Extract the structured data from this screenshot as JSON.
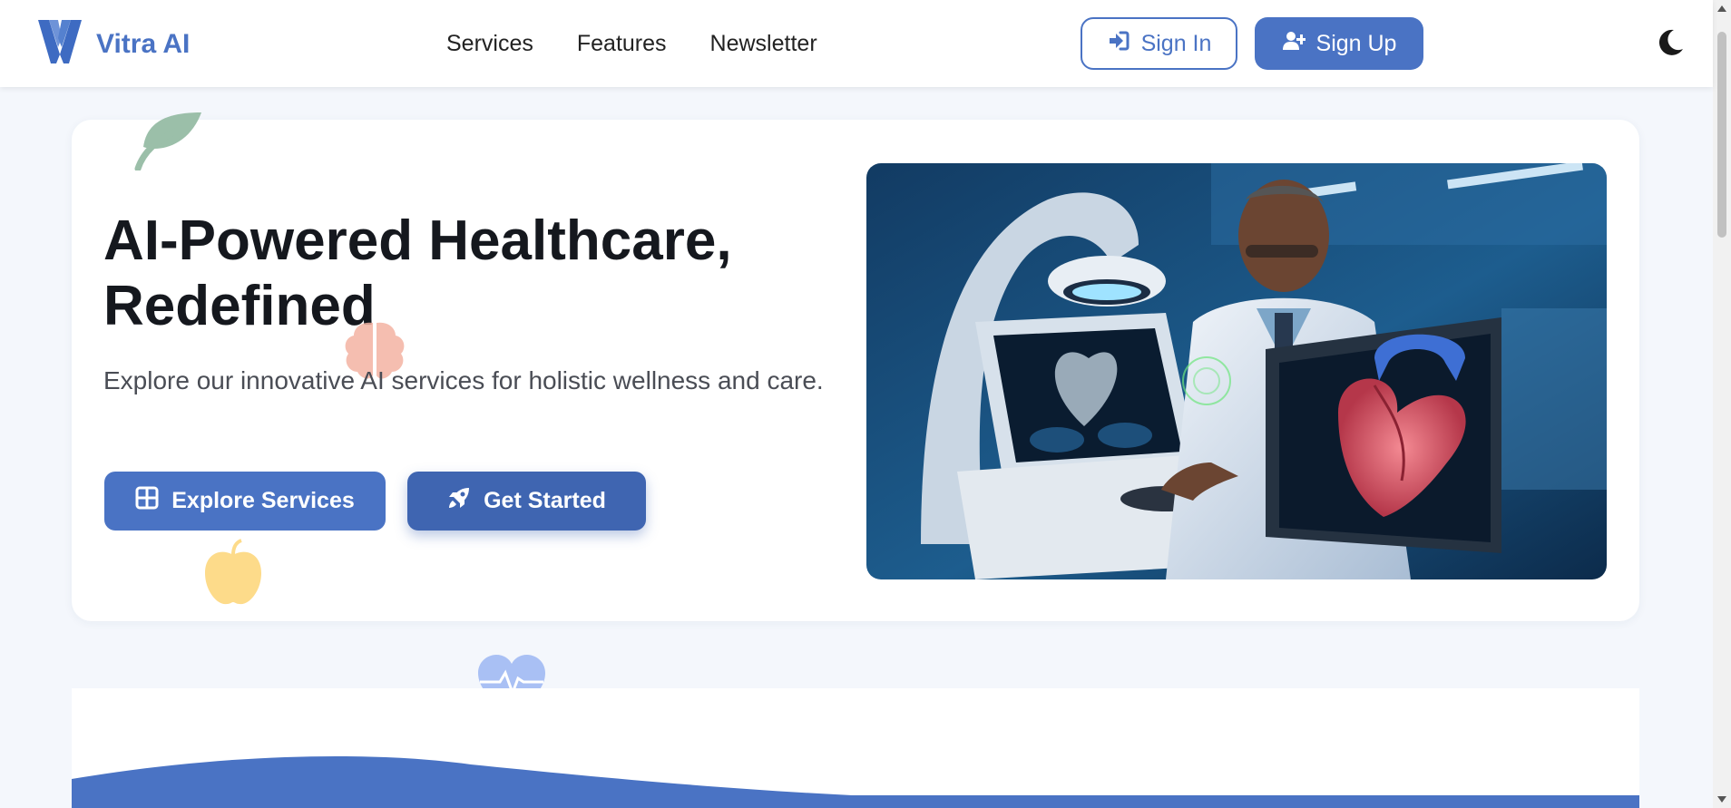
{
  "navbar": {
    "brand_name": "Vitra AI",
    "logo_icon": "vitra-logo-icon",
    "links": [
      {
        "label": "Services"
      },
      {
        "label": "Features"
      },
      {
        "label": "Newsletter"
      }
    ],
    "sign_in_label": "Sign In",
    "sign_in_icon": "sign-in-icon",
    "sign_up_label": "Sign Up",
    "sign_up_icon": "user-plus-icon",
    "theme_icon": "moon-icon"
  },
  "hero": {
    "title": "AI-Powered Healthcare, Redefined",
    "subtitle": "Explore our innovative AI services for holistic wellness and care.",
    "explore_label": "Explore Services",
    "explore_icon": "grid-icon",
    "get_started_label": "Get Started",
    "get_started_icon": "rocket-icon",
    "image_icon": "doctor-heart-scan-image"
  },
  "decor_icons": [
    "leaf-icon",
    "brain-icon",
    "apple-icon",
    "heart-pulse-icon"
  ],
  "colors": {
    "primary": "#4a73c4",
    "primary_dark": "#3f65b1",
    "background": "#f4f7fc",
    "leaf": "#9bbfa9",
    "brain": "#f4b3a3",
    "apple": "#fddb8a",
    "heart": "#a9c0f4"
  }
}
